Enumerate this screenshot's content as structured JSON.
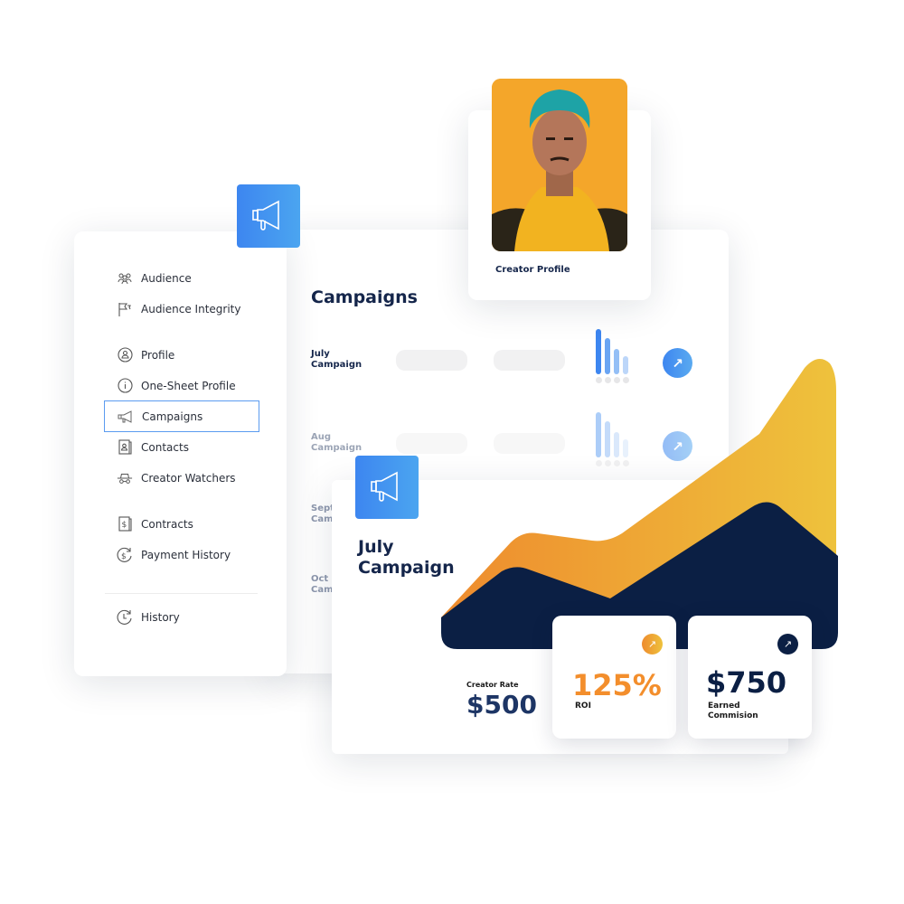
{
  "sidebar": {
    "items": [
      {
        "label": "Audience",
        "icon": "audience-icon"
      },
      {
        "label": "Audience Integrity",
        "icon": "flag-icon"
      },
      {
        "label": "Profile",
        "icon": "profile-icon"
      },
      {
        "label": "One-Sheet Profile",
        "icon": "info-icon"
      },
      {
        "label": "Campaigns",
        "icon": "megaphone-icon",
        "active": true
      },
      {
        "label": "Contacts",
        "icon": "contact-card-icon"
      },
      {
        "label": "Creator Watchers",
        "icon": "spy-icon"
      },
      {
        "label": "Contracts",
        "icon": "dollar-document-icon"
      },
      {
        "label": "Payment History",
        "icon": "dollar-history-icon"
      },
      {
        "label": "History",
        "icon": "history-icon"
      }
    ]
  },
  "creator_profile": {
    "label": "Creator Profile"
  },
  "campaigns": {
    "title": "Campaigns",
    "rows": [
      {
        "line1": "July",
        "line2": "Campaign"
      },
      {
        "line1": "Aug",
        "line2": "Campaign"
      },
      {
        "line1": "Sept",
        "line2": "Cam"
      },
      {
        "line1": "Oct",
        "line2": "Cam"
      }
    ]
  },
  "campaign_card": {
    "title_line1": "July",
    "title_line2": "Campaign",
    "creator_rate_label": "Creator Rate",
    "creator_rate_value": "$500",
    "roi_value": "125%",
    "roi_label": "ROI",
    "commission_value": "$750",
    "commission_label_line1": "Earned",
    "commission_label_line2": "Commision"
  },
  "colors": {
    "accent_blue": "#3d86f0",
    "navy": "#0b1f44",
    "orange": "#f0922e",
    "yellow": "#eebd3c"
  }
}
